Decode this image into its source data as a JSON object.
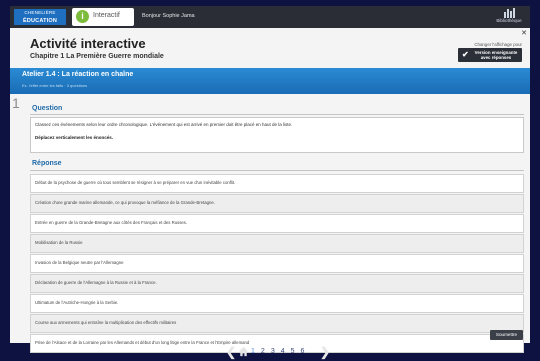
{
  "topbar": {
    "logo_line1": "CHENELIÈRE",
    "logo_line2": "ÉDUCATION",
    "app_name": "Interactif",
    "app_icon_letter": "i",
    "greeting": "Bonjour Sophie Jama",
    "library_label": "Bibliothèque"
  },
  "header": {
    "title": "Activité interactive",
    "subtitle": "Chapitre 1 La Première Guerre mondiale",
    "mode_caption": "Changer l'affichage pour",
    "mode_button_line1": "Version enseignante",
    "mode_button_line2": "avec réponses"
  },
  "workshop": {
    "title": "Atelier 1.4 : La réaction en chaîne",
    "subtitle": "Ex. l'effet entre les faits · 3 questions"
  },
  "question": {
    "number": "1",
    "heading": "Question",
    "instruction": "Classez ces événements selon leur ordre chronologique. L'événement qui est arrivé en premier doit être placé en haut de la liste.",
    "directive": "Déplacez verticalement les énoncés."
  },
  "answers": {
    "heading": "Réponse",
    "items": [
      "Début de la psychose de guerre où tous semblent se résigner à se préparer en vue d'un inévitable conflit.",
      "Création d'une grande marine allemande, ce qui provoque la méfiance de la Grande-Bretagne.",
      "Entrée en guerre de la Grande-Bretagne aux côtés des Français et des Russes.",
      "Mobilisation de la Russie",
      "Invasion de la Belgique neutre par l'Allemagne",
      "Déclaration de guerre de l'Allemagne à la Russie et à la France.",
      "Ultimatum de l'Autriche-Hongrie à la Serbie.",
      "Course aux armements qui entraîne la multiplication des effectifs militaires",
      "Prise de l'Alsace et de la Lorraine par les Allemands et début d'un long litige entre la France et l'Empire allemand"
    ],
    "submit_label": "Soumettre"
  },
  "nav": {
    "prev": "❮",
    "next": "❯",
    "pages": [
      "1",
      "2",
      "3",
      "4",
      "5",
      "6"
    ],
    "current_page": "1"
  },
  "colors": {
    "brand_blue": "#1f6fc0",
    "band_blue": "#2a8bd4",
    "interactif_green": "#7dbb3c",
    "heading_blue": "#1f6aa8"
  }
}
